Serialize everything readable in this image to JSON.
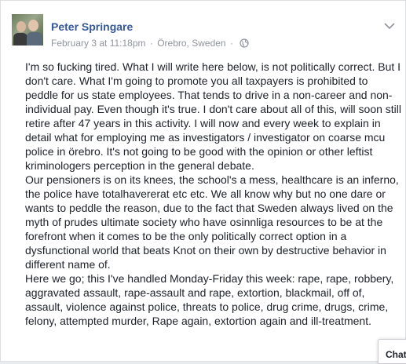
{
  "post": {
    "author": "Peter Springare",
    "timestamp": "February 3 at 11:18pm",
    "separator": "·",
    "location": "Örebro, Sweden",
    "privacy_separator": "·",
    "privacy_icon": "globe-icon",
    "menu_icon": "chevron-down-icon",
    "paragraphs": [
      "I'm so fucking tired. What I will write here below, is not politically correct. But I don't care. What I'm going to promote you all taxpayers is prohibited to peddle for us state employees. That tends to drive in a non-career and non-individual pay. Even though it's true. I don't care about all of this, will soon still retire after 47 years in this activity. I will now and every week to explain in detail what for employing me as investigators / investigator on coarse mcu police in örebro. It's not going to be good with the opinion or other leftist kriminologers perception in the general debate.",
      "Our pensioners is on its knees, the school's a mess, healthcare is an inferno, the police have totalhavererat etc etc. We all know why but no one dare or wants to peddle the reason, due to the fact that Sweden always lived on the myth of prudes ultimate society who have osinnliga resources to be at the forefront when it comes to be the only politically correct option in a dysfunctional world that beats Knot on their own by destructive behavior in different name of.",
      "Here we go; this I've handled Monday-Friday this week: rape, rape, robbery, aggravated assault, rape-assault and rape, extortion, blackmail, off of, assault, violence against police, threats to police, drug crime, drugs, crime, felony, attempted murder, Rape again, extortion again and ill-treatment."
    ]
  },
  "chat": {
    "label": "Chat"
  },
  "colors": {
    "link": "#365899",
    "meta": "#90949c",
    "text": "#1d2129"
  }
}
